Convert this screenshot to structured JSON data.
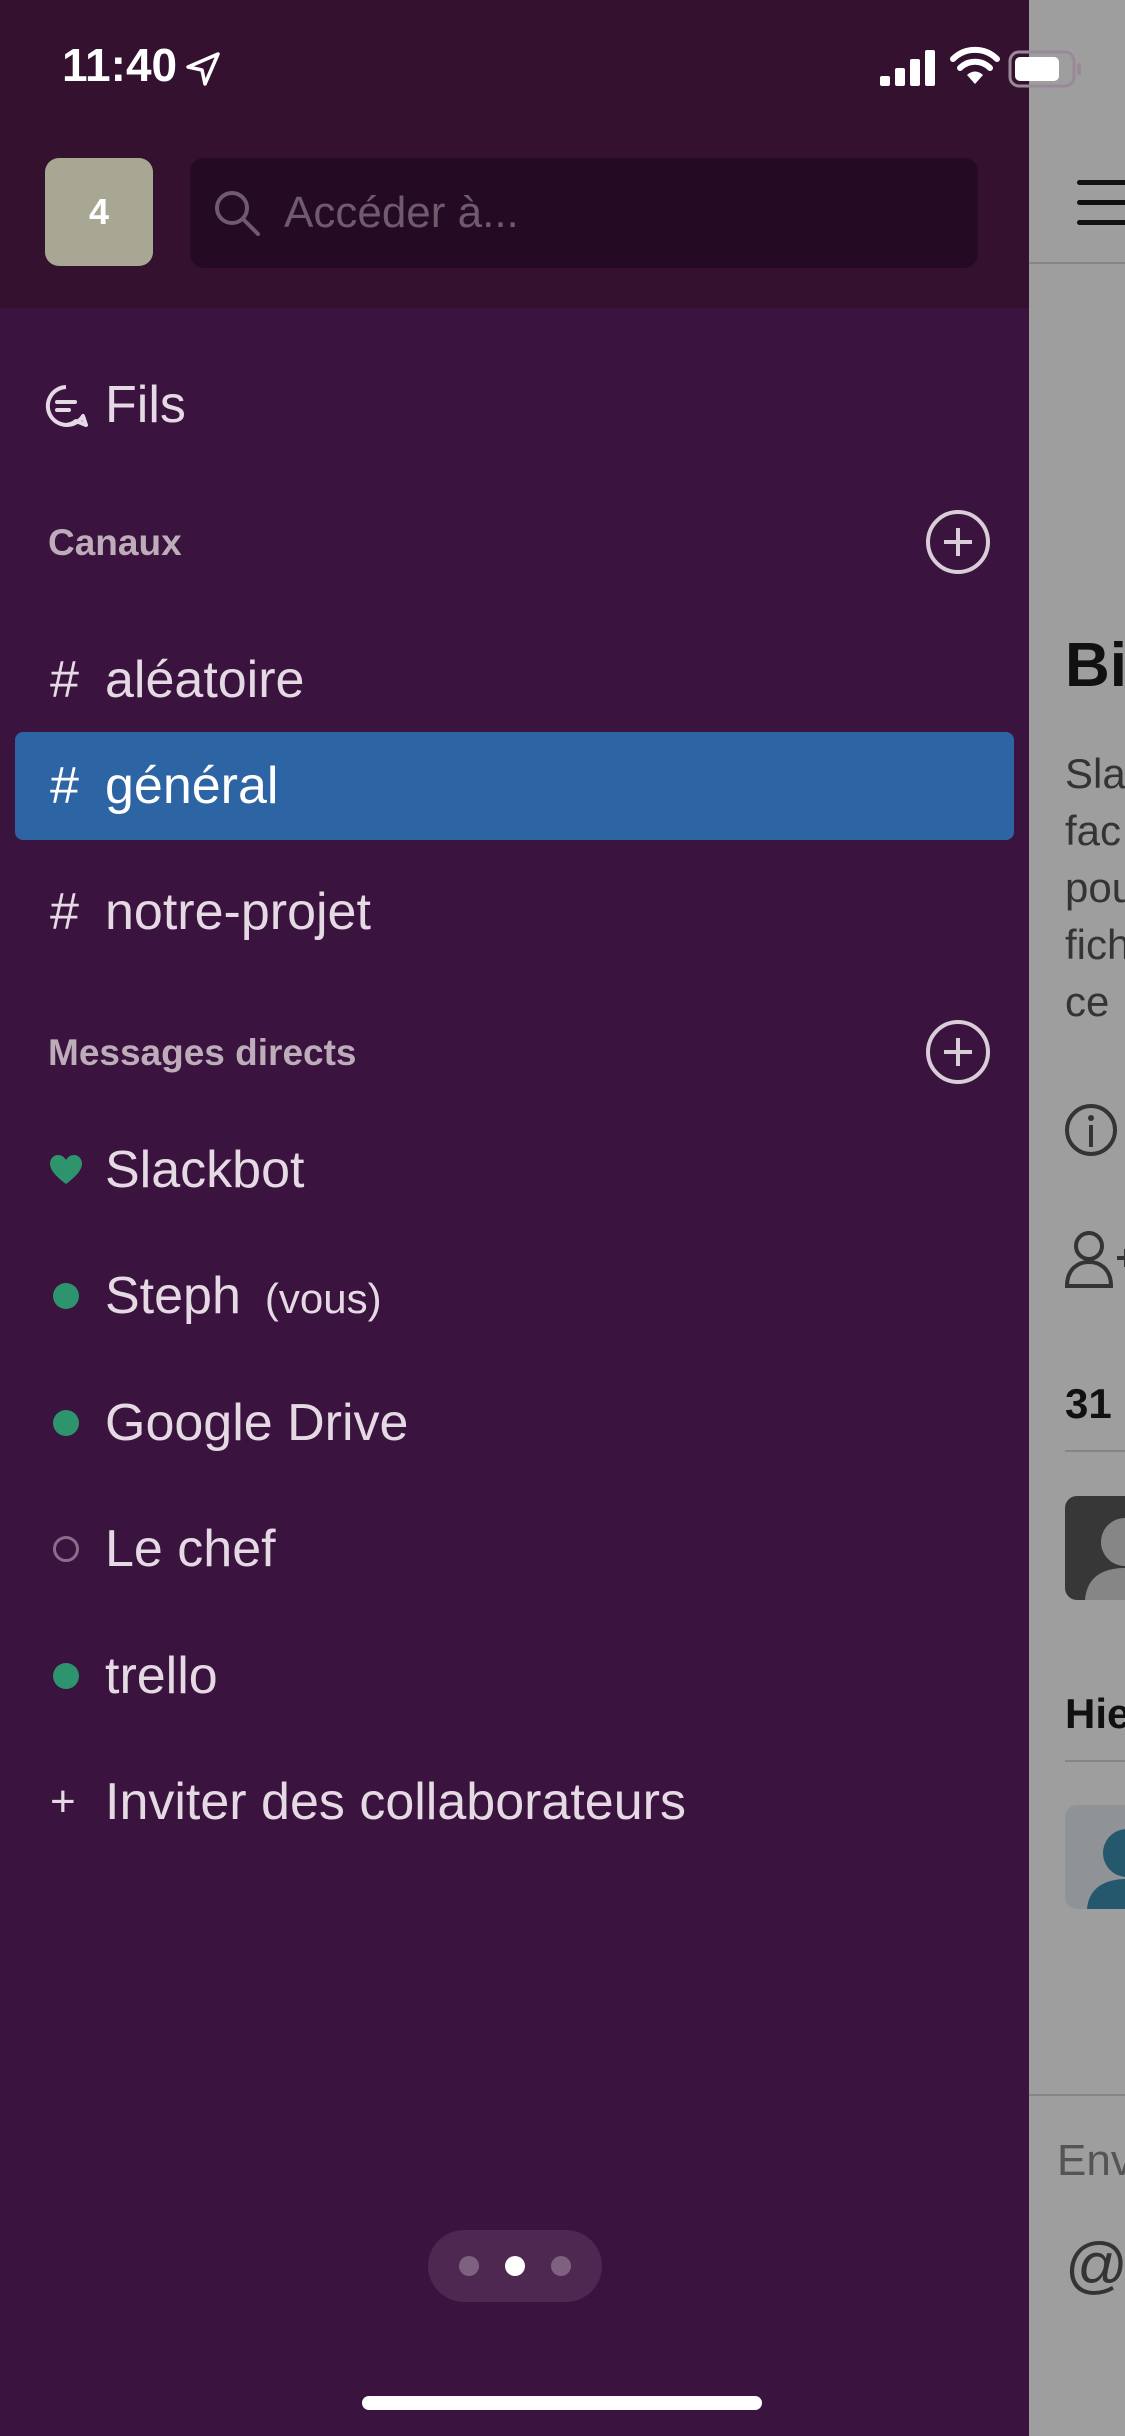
{
  "status_bar": {
    "time": "11:40"
  },
  "workspace": {
    "badge": "4"
  },
  "search": {
    "placeholder": "Accéder à..."
  },
  "threads": {
    "label": "Fils"
  },
  "channels": {
    "title": "Canaux",
    "items": [
      {
        "hash": "#",
        "name": "aléatoire"
      },
      {
        "hash": "#",
        "name": "général"
      },
      {
        "hash": "#",
        "name": "notre-projet"
      }
    ]
  },
  "direct_messages": {
    "title": "Messages directs",
    "items": [
      {
        "name": "Slackbot"
      },
      {
        "name": "Steph",
        "suffix": "(vous)"
      },
      {
        "name": "Google Drive"
      },
      {
        "name": "Le chef"
      },
      {
        "name": "trello"
      }
    ]
  },
  "invite": {
    "icon": "+",
    "label": "Inviter des collaborateurs"
  },
  "peek": {
    "title": "Bi",
    "desc": [
      "Sla",
      "fac",
      "pou",
      "fich",
      "ce"
    ],
    "section_date": "31",
    "section_2": "Hie",
    "input_placeholder": "Env",
    "at_symbol": "@"
  },
  "colors": {
    "sidebar_bg": "#3A133E",
    "topbar_bg": "#33112F",
    "selected": "#2D64A4",
    "online": "#2BAC76"
  }
}
